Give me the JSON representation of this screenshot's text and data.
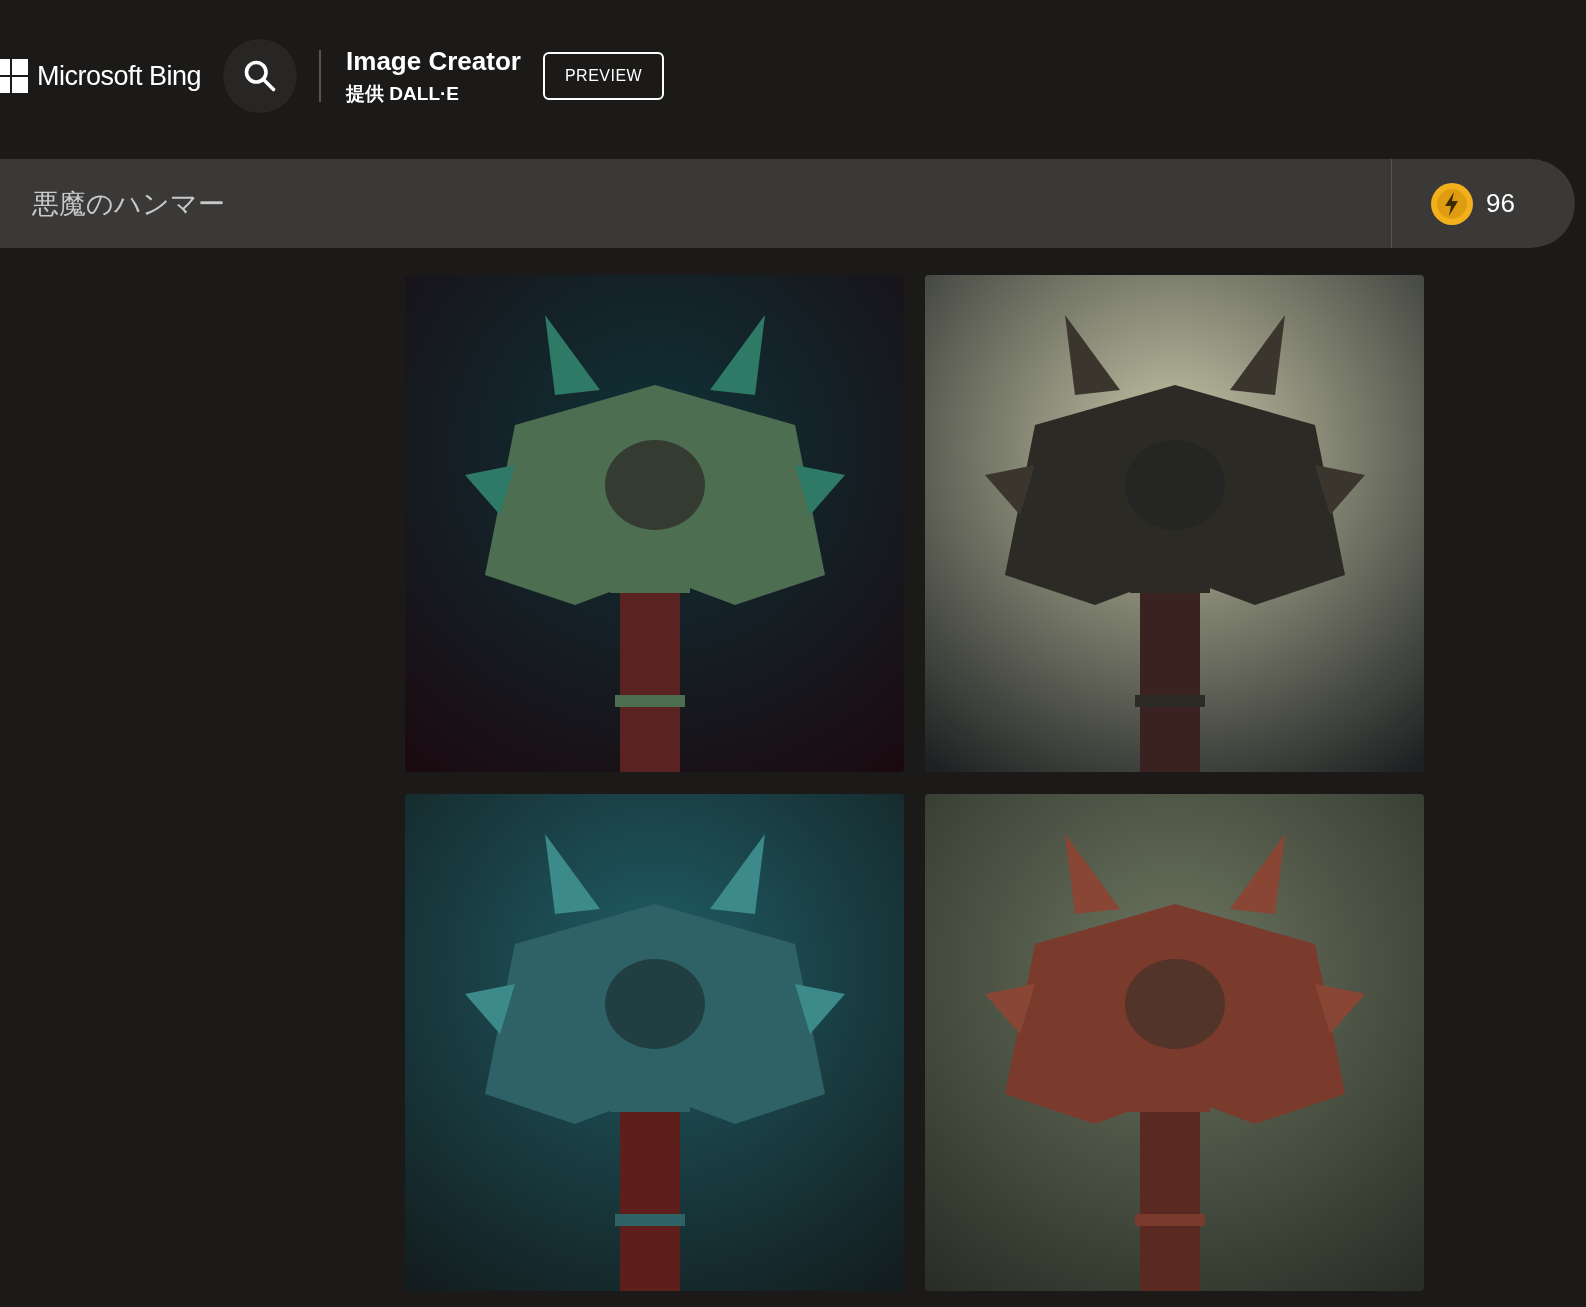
{
  "header": {
    "brand": "Microsoft Bing",
    "title": "Image Creator",
    "subtitle": "提供 DALL·E",
    "badge": "PREVIEW"
  },
  "prompt": {
    "value": "悪魔のハンマー",
    "boosts": "96"
  }
}
